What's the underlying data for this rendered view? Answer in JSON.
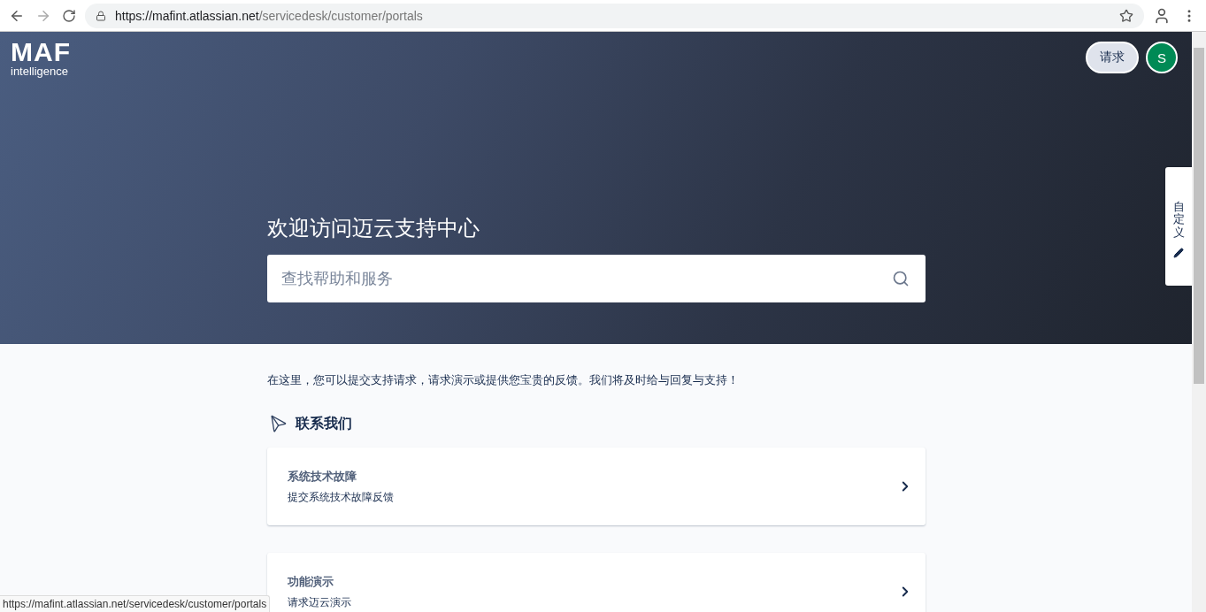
{
  "browser": {
    "url_host": "https://mafint.atlassian.net",
    "url_path": "/servicedesk/customer/portals",
    "status_url": "https://mafint.atlassian.net/servicedesk/customer/portals"
  },
  "header": {
    "logo_main": "MAF",
    "logo_sub": "intelligence",
    "requests_button": "请求",
    "avatar_initial": "S"
  },
  "hero": {
    "title": "欢迎访问迈云支持中心",
    "search": {
      "placeholder": "查找帮助和服务"
    }
  },
  "side_tab": {
    "label": "自定义"
  },
  "intro": "在这里，您可以提交支持请求，请求演示或提供您宝贵的反馈。我们将及时给与回复与支持！",
  "section": {
    "title": "联系我们"
  },
  "cards": [
    {
      "title": "系统技术故障",
      "description": "提交系统技术故障反馈"
    },
    {
      "title": "功能演示",
      "description": "请求迈云演示"
    }
  ]
}
